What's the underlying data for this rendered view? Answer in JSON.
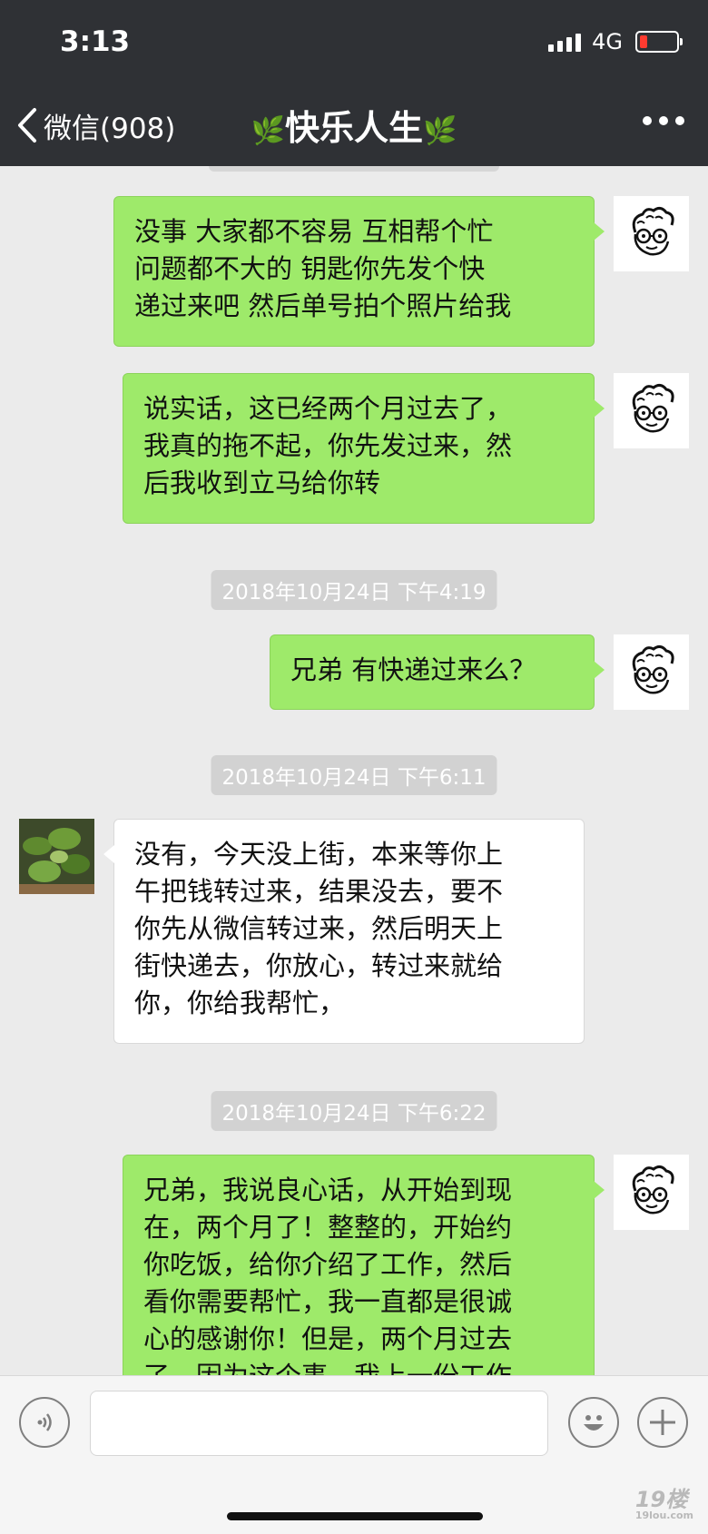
{
  "status_bar": {
    "time": "3:13",
    "network": "4G"
  },
  "nav": {
    "back_label": "微信(908)",
    "title": "快乐人生"
  },
  "messages": [
    {
      "side": "right",
      "text": "没事  大家都不容易  互相帮个忙\n问题都不大的    钥匙你先发个快\n递过来吧 然后单号拍个照片给我"
    },
    {
      "side": "right",
      "text": "说实话，这已经两个月过去了，\n我真的拖不起，你先发过来，然\n后我收到立马给你转"
    },
    {
      "timestamp": "2018年10月24日 下午4:19"
    },
    {
      "side": "right",
      "text": "兄弟 有快递过来么？"
    },
    {
      "timestamp": "2018年10月24日 下午6:11"
    },
    {
      "side": "left",
      "text": "没有，今天没上街，本来等你上\n午把钱转过来，结果没去，要不\n你先从微信转过来，然后明天上\n街快递去，你放心，转过来就给\n你，你给我帮忙，"
    },
    {
      "timestamp": "2018年10月24日 下午6:22"
    },
    {
      "side": "right",
      "text": "兄弟，我说良心话，从开始到现\n在，两个月了！整整的，开始约\n你吃饭，给你介绍了工作，然后\n看你需要帮忙，我一直都是很诚\n心的感谢你！但是，两个月过去\n了，因为这个事，我上一份工作"
    }
  ],
  "input_bar": {
    "voice_icon": "voice-icon",
    "emoji_icon": "emoji-icon",
    "plus_icon": "plus-icon"
  },
  "watermark": {
    "main": "19楼",
    "sub": "19lou.com"
  },
  "colors": {
    "my_bubble": "#9eea6a",
    "their_bubble": "#ffffff",
    "nav_bg": "#2f3135",
    "chat_bg": "#ebebeb"
  }
}
